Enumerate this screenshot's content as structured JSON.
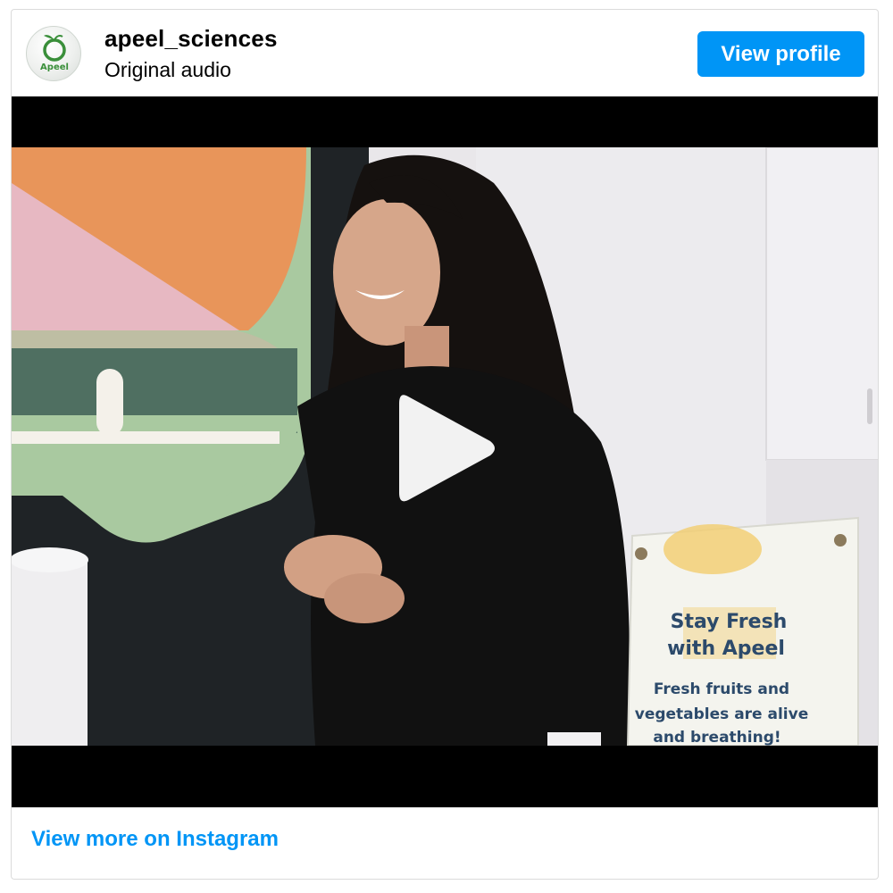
{
  "profile": {
    "username": "apeel_sciences",
    "audio_label": "Original audio",
    "avatar_text": "Apeel",
    "view_profile_label": "View profile"
  },
  "video": {
    "play_icon": "play-icon",
    "sign": {
      "title_line1": "Stay Fresh",
      "title_line2": "with Apeel",
      "body_line1": "Fresh fruits and",
      "body_line2": "vegetables are alive",
      "body_line3": "and breathing!"
    }
  },
  "footer": {
    "link_label": "View more on Instagram"
  },
  "colors": {
    "accent": "#0095f6",
    "brand_green": "#3a8f3a"
  }
}
